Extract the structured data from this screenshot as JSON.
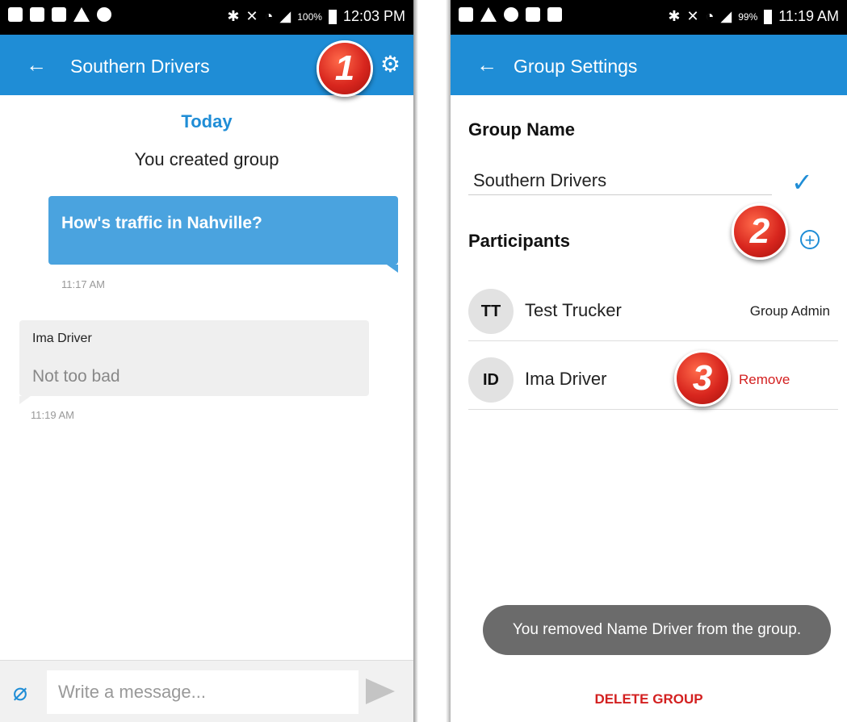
{
  "left_phone": {
    "status": {
      "battery": "100%",
      "time": "12:03 PM"
    },
    "appbar": {
      "back_icon": "arrow-left-icon",
      "title": "Southern Drivers",
      "settings_icon": "gear-icon"
    },
    "callout": "1",
    "chat": {
      "date_header": "Today",
      "system_message": "You created group",
      "outgoing": {
        "text": "How's traffic in Nahville?",
        "time": "11:17 AM"
      },
      "incoming": {
        "sender": "Ima Driver",
        "text": "Not too bad",
        "time": "11:19 AM"
      }
    },
    "composer": {
      "attach_icon": "paperclip-icon",
      "placeholder": "Write a message...",
      "send_icon": "send-icon"
    }
  },
  "right_phone": {
    "status": {
      "battery": "99%",
      "time": "11:19 AM"
    },
    "appbar": {
      "back_icon": "arrow-left-icon",
      "title": "Group Settings"
    },
    "group_name_label": "Group Name",
    "group_name_value": "Southern Drivers",
    "participants_label": "Participants",
    "callout_2": "2",
    "callout_3": "3",
    "participants": [
      {
        "initials": "TT",
        "name": "Test Trucker",
        "action": "Group Admin"
      },
      {
        "initials": "ID",
        "name": "Ima Driver",
        "action": "Remove"
      }
    ],
    "toast": "You removed Name Driver from the group.",
    "delete_label": "DELETE GROUP"
  },
  "colors": {
    "primary": "#1f8dd6",
    "danger": "#d32020",
    "callout": "#d8261e"
  }
}
